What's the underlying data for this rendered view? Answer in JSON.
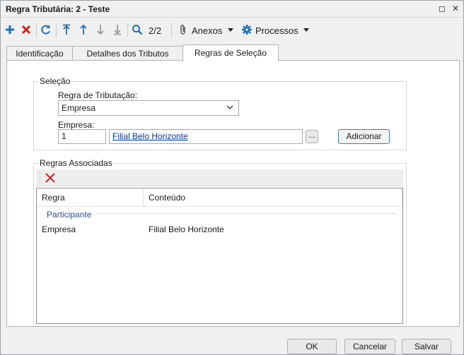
{
  "window": {
    "title": "Regra Tributária: 2 - Teste",
    "maximize_glyph": "◻",
    "close_glyph": "✕"
  },
  "toolbar": {
    "page_counter": "2/2",
    "attachments_label": "Anexos",
    "processes_label": "Processos",
    "icons": [
      "plus-icon",
      "delete-x-icon",
      "refresh-icon",
      "move-first-icon",
      "move-up-icon",
      "move-down-icon",
      "move-last-icon",
      "search-icon",
      "paperclip-icon",
      "gear-icon"
    ]
  },
  "tabs": [
    {
      "label": "Identificação",
      "active": false
    },
    {
      "label": "Detalhes dos Tributos",
      "active": false
    },
    {
      "label": "Regras de Seleção",
      "active": true
    }
  ],
  "selection": {
    "group_title": "Seleção",
    "rule_label": "Regra de Tributação:",
    "rule_value": "Empresa",
    "company_label": "Empresa:",
    "company_code": "1",
    "company_name": "Filial Belo Horizonte",
    "browse_label": "...",
    "add_label": "Adicionar"
  },
  "associated": {
    "group_title": "Regras Associadas",
    "columns": [
      "Regra",
      "Conteúdo"
    ],
    "group_name": "Participante",
    "rows": [
      {
        "rule": "Empresa",
        "content": "Filial Belo Horizonte"
      }
    ]
  },
  "footer": {
    "ok_label": "OK",
    "cancel_label": "Cancelar",
    "save_label": "Salvar"
  },
  "colors": {
    "accent_blue": "#1f6fb5",
    "delete_red": "#cc2222",
    "link_blue": "#0033cc",
    "group_blue": "#2a4ea0"
  }
}
